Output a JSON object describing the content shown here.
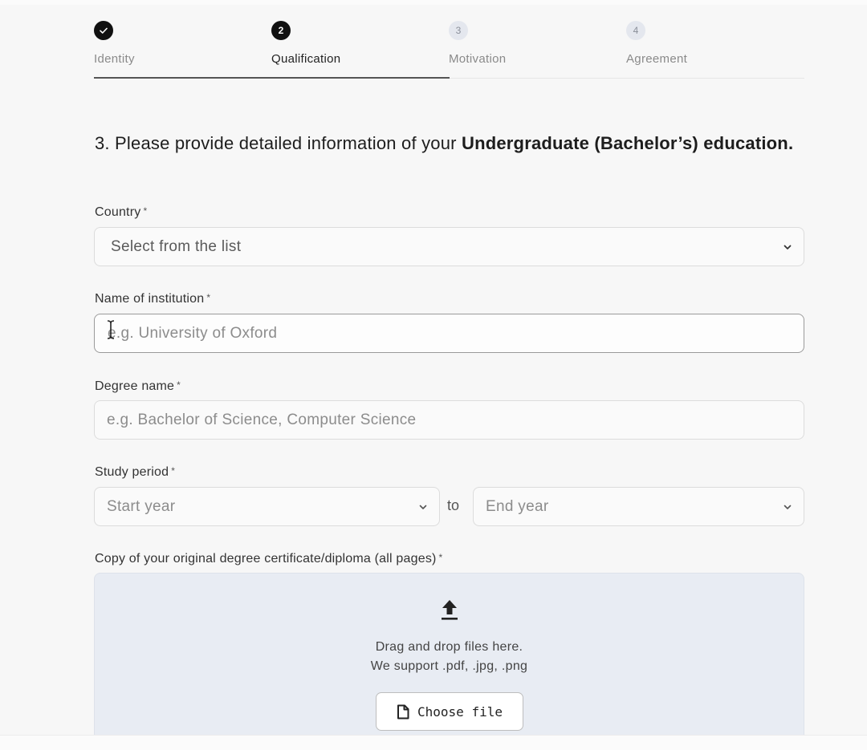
{
  "stepper": {
    "steps": [
      {
        "number": "",
        "label": "Identity",
        "state": "done"
      },
      {
        "number": "2",
        "label": "Qualification",
        "state": "active"
      },
      {
        "number": "3",
        "label": "Motivation",
        "state": "todo"
      },
      {
        "number": "4",
        "label": "Agreement",
        "state": "todo"
      }
    ]
  },
  "question": {
    "prefix": "3. Please provide detailed information of your ",
    "bold": "Undergraduate (Bachelor’s) education."
  },
  "country": {
    "label": "Country",
    "placeholder": "Select from the list"
  },
  "institution": {
    "label": "Name of institution",
    "placeholder": "e.g. University of Oxford"
  },
  "degree": {
    "label": "Degree name",
    "placeholder": "e.g. Bachelor of Science, Computer Science"
  },
  "study_period": {
    "label": "Study period",
    "start_placeholder": "Start year",
    "separator": "to",
    "end_placeholder": "End year"
  },
  "certificate": {
    "label": "Copy of your original degree certificate/diploma (all pages)",
    "drop_line1": "Drag and drop files here.",
    "drop_line2": "We support .pdf, .jpg, .png",
    "button_label": "Choose file"
  },
  "required_mark": "*"
}
